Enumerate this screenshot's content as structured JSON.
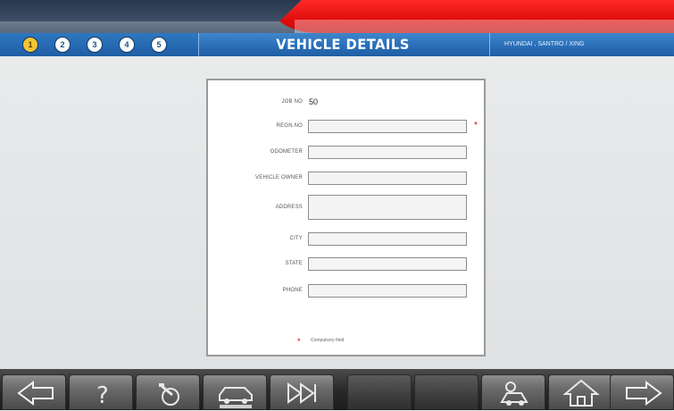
{
  "header": {
    "title": "VEHICLE DETAILS",
    "vehicle": "HYUNDAI , SANTRO / XING",
    "steps": [
      "1",
      "2",
      "3",
      "4",
      "5"
    ]
  },
  "form": {
    "job_no_label": "JOB NO",
    "job_no_value": "50",
    "reg_no_label": "REGN.NO",
    "odometer_label": "ODOMETER",
    "owner_label": "VEHICLE OWNER",
    "address_label": "ADDRESS",
    "city_label": "CITY",
    "state_label": "STATE",
    "phone_label": "PHONE",
    "required_marker": "*",
    "footnote_marker": "*",
    "footnote": "Compulsory field"
  },
  "toolbar": {
    "buttons": [
      "back-arrow-icon",
      "help-icon",
      "vehicle-tools-icon",
      "vehicle-details-icon",
      "skip-forward-icon",
      "blank",
      "blank",
      "car-mechanic-icon",
      "home-icon",
      "next-arrow-icon"
    ]
  },
  "colors": {
    "title_bar": "#2a6fb8",
    "accent_red": "#e00d0d",
    "active_step": "#f4c531",
    "required": "#d10000"
  }
}
